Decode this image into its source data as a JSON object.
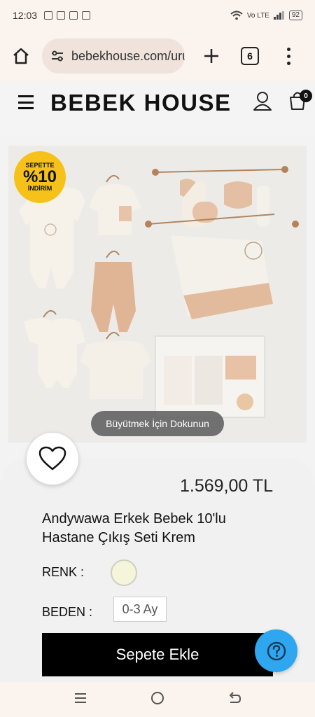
{
  "status_bar": {
    "time": "12:03",
    "battery": "92",
    "network": "Vo LTE"
  },
  "browser": {
    "url": "bebekhouse.com/uru",
    "tab_count": "6"
  },
  "site": {
    "logo": "BEBEK HOUSE",
    "cart_count": "0"
  },
  "product": {
    "promo": {
      "line1": "SEPETTE",
      "line2": "%10",
      "line3": "İNDİRİM"
    },
    "zoom_hint": "Büyütmek İçin Dokunun",
    "price": "1.569,00 TL",
    "title": "Andywawa Erkek Bebek 10'lu Hastane Çıkış Seti Krem",
    "color_label": "RENK :",
    "color_value": "#f5f5dc",
    "size_label": "BEDEN :",
    "size_selected": "0-3 Ay",
    "add_to_cart": "Sepete Ekle"
  },
  "icons": {
    "home": "home-icon",
    "tune": "tune-icon",
    "plus": "plus-icon",
    "menu": "more-vert-icon",
    "hamburger": "hamburger-icon",
    "user": "user-icon",
    "cart": "cart-icon",
    "heart": "heart-icon",
    "help": "help-icon",
    "nav_recent": "recent-apps-icon",
    "nav_home": "home-circle-icon",
    "nav_back": "back-icon"
  }
}
